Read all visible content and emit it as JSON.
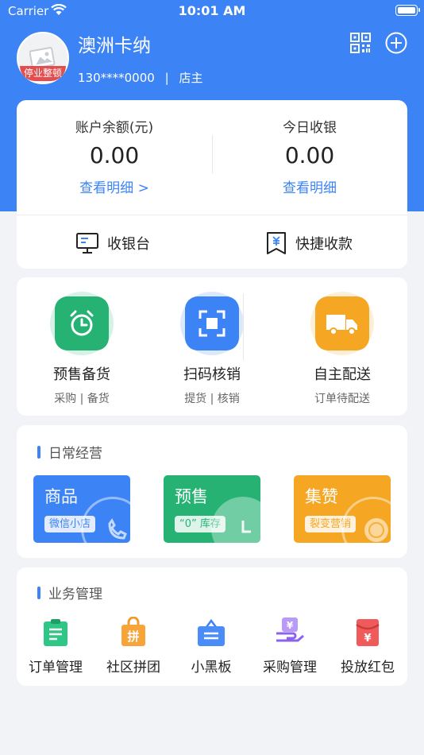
{
  "status_bar": {
    "carrier": "Carrier",
    "time": "10:01 AM"
  },
  "header": {
    "store_name": "澳洲卡纳",
    "avatar_badge": "停业整顿",
    "phone": "130****0000",
    "separator": "|",
    "role": "店主"
  },
  "balance": {
    "account_label": "账户余额(元)",
    "account_value": "0.00",
    "account_link": "查看明细 >",
    "today_label": "今日收银",
    "today_value": "0.00",
    "today_link": "查看明细",
    "cashier_label": "收银台",
    "quick_pay_label": "快捷收款"
  },
  "functions": [
    {
      "title": "预售备货",
      "sub": "采购 | 备货",
      "color": "#25b273"
    },
    {
      "title": "扫码核销",
      "sub": "提货 | 核销",
      "color": "#3c83f6"
    },
    {
      "title": "自主配送",
      "sub": "订单待配送",
      "color": "#f5a623"
    }
  ],
  "daily": {
    "section_title": "日常经营",
    "cards": [
      {
        "title": "商品",
        "chip": "微信小店",
        "color": "#3c83f6"
      },
      {
        "title": "预售",
        "chip": "“0” 库存",
        "color": "#25b273"
      },
      {
        "title": "集赞",
        "chip": "裂变营销",
        "color": "#f5a623"
      }
    ]
  },
  "business": {
    "section_title": "业务管理",
    "items": [
      {
        "label": "订单管理",
        "icon": "clipboard-icon"
      },
      {
        "label": "社区拼团",
        "icon": "group-buy-bag-icon"
      },
      {
        "label": "小黑板",
        "icon": "blackboard-icon"
      },
      {
        "label": "采购管理",
        "icon": "purchase-icon"
      },
      {
        "label": "投放红包",
        "icon": "red-envelope-icon"
      }
    ]
  }
}
